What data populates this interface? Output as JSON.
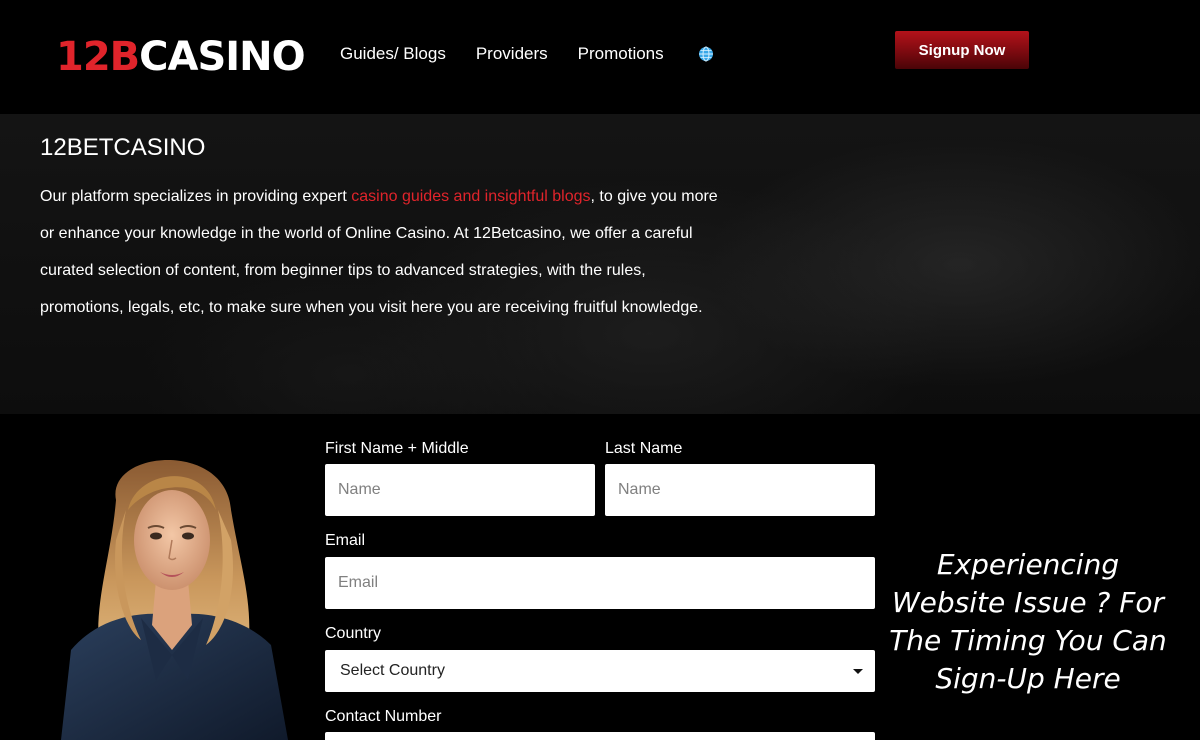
{
  "header": {
    "logo_part1": "12B",
    "logo_part2": "CASINO",
    "nav": [
      "Guides/ Blogs",
      "Providers",
      "Promotions"
    ],
    "globe_icon": "globe-icon",
    "signup_label": "Signup Now"
  },
  "hero": {
    "title": "12BETCASINO",
    "text_before": " Our platform specializes in providing expert ",
    "link_text": "casino guides and insightful blogs",
    "text_after": ", to give you more or enhance your knowledge in the world of Online Casino. At 12Betcasino, we offer a careful curated selection of content, from beginner tips to advanced strategies, with the rules, promotions, legals, etc, to make sure when you visit here you are receiving fruitful knowledge."
  },
  "form": {
    "first_name_label": "First Name + Middle",
    "first_name_placeholder": "Name",
    "last_name_label": "Last Name",
    "last_name_placeholder": "Name",
    "email_label": "Email",
    "email_placeholder": "Email",
    "country_label": "Country",
    "country_selected": "Select Country",
    "contact_label": "Contact Number"
  },
  "side_message": "Experiencing Website Issue ? For The Timing You Can Sign-Up Here",
  "colors": {
    "accent_red": "#e0242b",
    "button_red": "#9e1017",
    "background": "#000000"
  }
}
